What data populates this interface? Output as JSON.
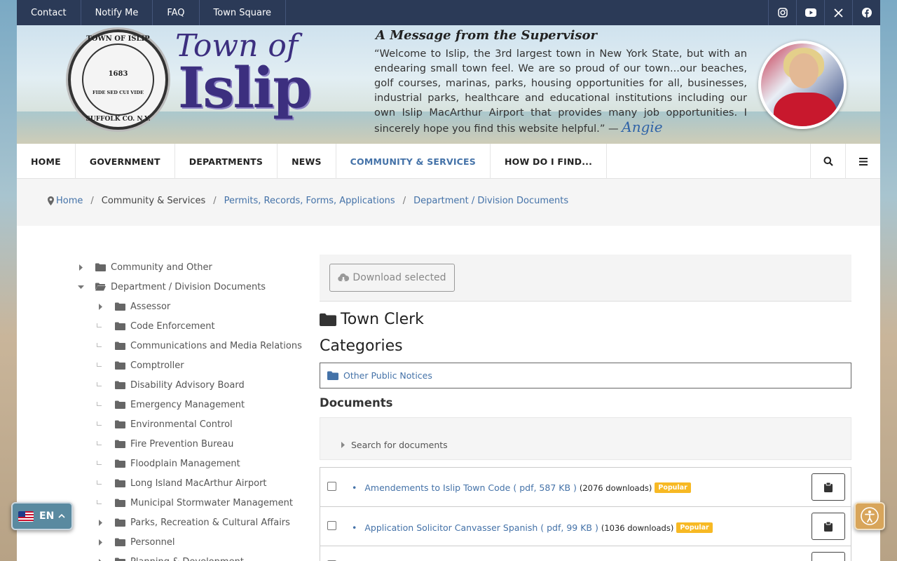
{
  "utility_nav": {
    "links": [
      "Contact",
      "Notify Me",
      "FAQ",
      "Town Square"
    ],
    "social": [
      "instagram-icon",
      "youtube-icon",
      "x-icon",
      "facebook-icon"
    ]
  },
  "banner": {
    "seal_top": "TOWN OF ISLIP",
    "seal_year": "1683",
    "seal_motto": "FIDE SED CUI VIDE",
    "seal_bottom": "SUFFOLK CO. N.Y.",
    "logo_line1": "Town of",
    "logo_line2": "Islip",
    "message_title": "A Message from the Supervisor",
    "message_body": "“Welcome to Islip, the 3rd largest town in New York State, but with an endearing small town feel. We are so proud of our town...our beaches, golf courses, marinas, parks, housing opportunities for all, businesses, industrial parks, healthcare and educational institutions including our own Islip MacArthur Airport that provides many job opportunities. I sincerely hope you find this website helpful.” —",
    "signature": "Angie"
  },
  "main_nav": {
    "items": [
      "HOME",
      "GOVERNMENT",
      "DEPARTMENTS",
      "NEWS",
      "COMMUNITY & SERVICES",
      "HOW DO I FIND..."
    ],
    "active": "COMMUNITY & SERVICES"
  },
  "breadcrumb": {
    "items": [
      "Home",
      "Community & Services",
      "Permits, Records, Forms, Applications",
      "Department / Division Documents"
    ]
  },
  "tree": {
    "items": [
      {
        "label": "Community and Other",
        "level": 0,
        "state": "collapsed"
      },
      {
        "label": "Department / Division Documents",
        "level": 0,
        "state": "expanded"
      },
      {
        "label": "Assessor",
        "level": 1,
        "state": "collapsed"
      },
      {
        "label": "Code Enforcement",
        "level": 1,
        "state": "leaf"
      },
      {
        "label": "Communications and Media Relations",
        "level": 1,
        "state": "leaf"
      },
      {
        "label": "Comptroller",
        "level": 1,
        "state": "leaf"
      },
      {
        "label": "Disability Advisory Board",
        "level": 1,
        "state": "leaf"
      },
      {
        "label": "Emergency Management",
        "level": 1,
        "state": "leaf"
      },
      {
        "label": "Environmental Control",
        "level": 1,
        "state": "leaf"
      },
      {
        "label": "Fire Prevention Bureau",
        "level": 1,
        "state": "leaf"
      },
      {
        "label": "Floodplain Management",
        "level": 1,
        "state": "leaf"
      },
      {
        "label": "Long Island MacArthur Airport",
        "level": 1,
        "state": "leaf"
      },
      {
        "label": "Municipal Stormwater Management",
        "level": 1,
        "state": "leaf"
      },
      {
        "label": "Parks, Recreation & Cultural Affairs",
        "level": 1,
        "state": "collapsed"
      },
      {
        "label": "Personnel",
        "level": 1,
        "state": "collapsed"
      },
      {
        "label": "Planning & Development",
        "level": 1,
        "state": "collapsed"
      }
    ]
  },
  "content": {
    "download_label": "Download selected",
    "category_title": "Town Clerk",
    "categories_heading": "Categories",
    "category_item": "Other Public Notices",
    "documents_heading": "Documents",
    "search_label": "Search for documents",
    "documents": [
      {
        "title": "Amendements to Islip Town Code ( pdf, 587 KB )",
        "downloads": "(2076 downloads)",
        "badge": "Popular"
      },
      {
        "title": "Application Solicitor Canvasser Spanish ( pdf, 99 KB )",
        "downloads": "(1036 downloads)",
        "badge": "Popular"
      }
    ]
  },
  "widgets": {
    "language": "EN"
  },
  "colors": {
    "utility_bg": "#2b3a57",
    "link": "#4472a8",
    "badge": "#f7b924",
    "logo": "#3c2f7f"
  }
}
